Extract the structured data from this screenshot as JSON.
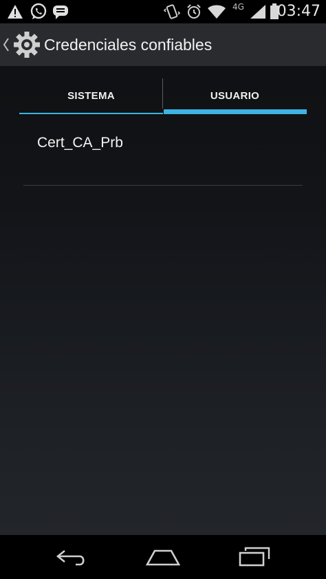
{
  "status_bar": {
    "time": "03:47",
    "network": "4G",
    "icons": [
      "warning-icon",
      "whatsapp-icon",
      "message-icon",
      "vibrate-icon",
      "alarm-icon",
      "wifi-icon",
      "signal-icon",
      "battery-icon"
    ]
  },
  "action_bar": {
    "title": "Credenciales confiables",
    "icons": [
      "back-chevron-icon",
      "settings-gear-icon"
    ]
  },
  "tabs": [
    {
      "label": "SISTEMA",
      "selected": false
    },
    {
      "label": "USUARIO",
      "selected": true
    }
  ],
  "list": {
    "items": [
      {
        "label": "Cert_CA_Prb"
      }
    ]
  },
  "nav_bar": {
    "icons": [
      "back-icon",
      "home-icon",
      "recents-icon"
    ]
  },
  "colors": {
    "accent": "#3db3e4",
    "action_bar": "#292b2f",
    "status_bar": "#000000"
  }
}
